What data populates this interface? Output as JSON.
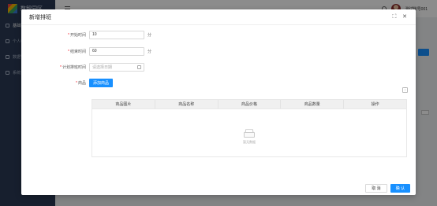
{
  "app": {
    "brand_name": "数智园区",
    "sidebar": [
      {
        "label": "基础数据",
        "active": true
      },
      {
        "label": "个人中心",
        "active": false
      },
      {
        "label": "数据管理",
        "active": false
      },
      {
        "label": "系统设置",
        "active": false
      }
    ],
    "username": "测试账号001"
  },
  "modal": {
    "title": "新增排班",
    "fullscreen_icon": "⛶",
    "close_icon": "✕",
    "fields": {
      "start_label": "开始时间",
      "start_value": "10",
      "start_unit": "分",
      "end_label": "结束时间",
      "end_value": "60",
      "end_unit": "分",
      "date_label": "计划排班时间",
      "date_placeholder": "请选择日期",
      "product_label": "商品",
      "add_button": "添加商品"
    },
    "table": {
      "columns": [
        "商品图片",
        "商品名称",
        "商品价格",
        "商品数量",
        "操作"
      ],
      "empty_text": "暂无数据"
    },
    "footer": {
      "cancel": "取 消",
      "ok": "确 认"
    }
  }
}
